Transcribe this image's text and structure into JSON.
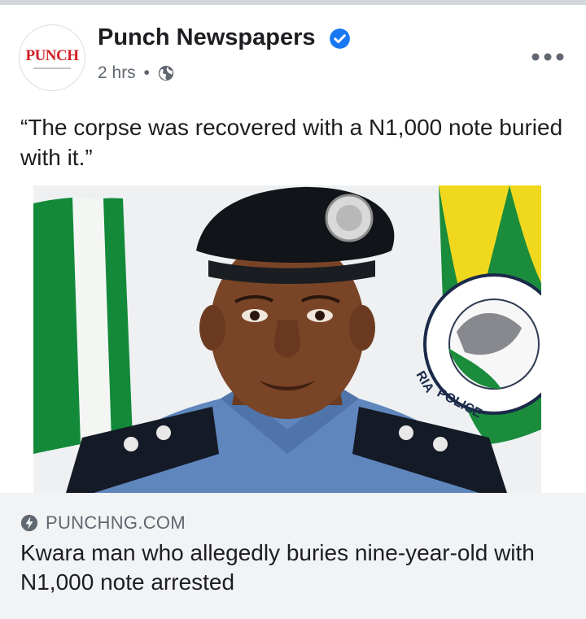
{
  "post": {
    "page_name": "Punch Newspapers",
    "avatar_text": "PUNCH",
    "time": "2 hrs",
    "separator": "•",
    "caption": "“The corpse was recovered with a N1,000 note buried with it.”"
  },
  "link_preview": {
    "domain": "PUNCHNG.COM",
    "headline": "Kwara man who allegedly buries nine-year-old with N1,000 note arrested"
  },
  "photo_text": {
    "flag_text_1": "RIA",
    "flag_text_2": "POLICE"
  },
  "colors": {
    "verified": "#1877f2",
    "secondary_text": "#606770",
    "link_background": "#f2f3f5",
    "nigeria_green": "#128a3a"
  },
  "icons": [
    "verified-badge-icon",
    "globe-icon",
    "more-options-icon",
    "bolt-icon"
  ]
}
